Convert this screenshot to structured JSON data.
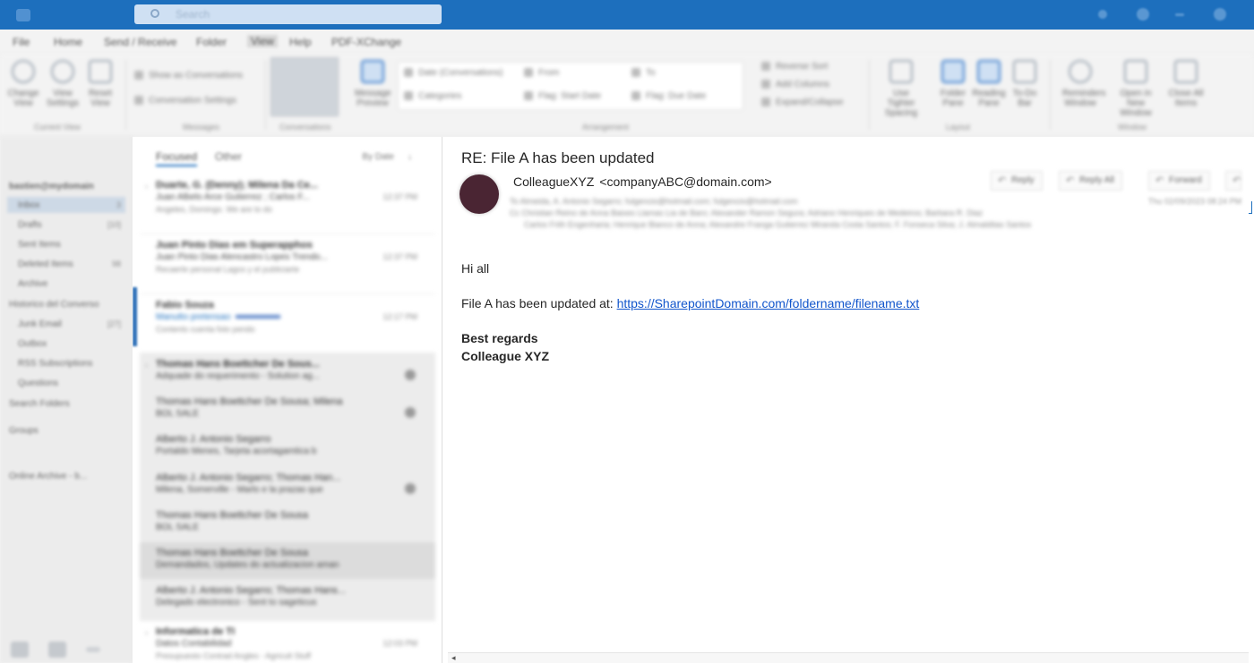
{
  "titlebar": {
    "search_placeholder": "Search"
  },
  "menu": [
    "File",
    "Home",
    "Send / Receive",
    "Folder",
    "View",
    "Help",
    "PDF-XChange"
  ],
  "ribbon": {
    "buttons": [
      "Change View",
      "View Settings",
      "Reset View",
      "Show as Conversations",
      "Conversation Settings",
      "Message Preview",
      "Arrange By",
      "Reverse Sort",
      "Add Columns",
      "Expand/Collapse",
      "Use Tighter Spacing",
      "Folder Pane",
      "Reading Pane",
      "To-Do Bar",
      "Reminders Window",
      "Open in New Window",
      "Close All Items"
    ],
    "groups": [
      "Current View",
      "Messages",
      "Conversations",
      "Arrangement",
      "Layout",
      "Window"
    ],
    "arrangement": [
      "Date (Conversations)",
      "From",
      "To",
      "Categories",
      "Flag: Start Date",
      "Flag: Due Date"
    ]
  },
  "folder_pane": {
    "account": "bastien@mydomain",
    "items": [
      {
        "label": "Inbox",
        "count": "3"
      },
      {
        "label": "Drafts",
        "count": "[10]"
      },
      {
        "label": "Sent Items",
        "count": ""
      },
      {
        "label": "Deleted Items",
        "count": "98"
      },
      {
        "label": "Archive",
        "count": ""
      },
      {
        "label": "Historico del Converso",
        "count": ""
      },
      {
        "label": "Junk Email",
        "count": "[27]"
      },
      {
        "label": "Outbox",
        "count": ""
      },
      {
        "label": "RSS Subscriptions",
        "count": ""
      },
      {
        "label": "Questions",
        "count": ""
      },
      {
        "label": "Search Folders",
        "count": ""
      },
      {
        "label": "Groups",
        "count": ""
      },
      {
        "label": "Online Archive - b...",
        "count": ""
      }
    ]
  },
  "message_list": {
    "tabs": [
      "Focused",
      "Other"
    ],
    "sort": "By Date",
    "rows": [
      {
        "sender": "Duarte, G. (Denny); Milena Da Ce...",
        "subject": "Juan Albelo Arce Gutierrez ; Carlos F...",
        "preview": "Angeles, Domingo. We are to do",
        "time": "12:37 PM",
        "badge": false
      },
      {
        "sender": "Juan Pinto Dias em Superapphos",
        "subject": "Juan Pinto Dias Alencastro Lopes Trendo...",
        "preview": "Recaerle personal Lagos y el publiciarte",
        "time": "12:37 PM",
        "badge": false
      },
      {
        "sender": "Fabio Souza",
        "subject": "Manutto pretensao",
        "preview": "Contents cuenta foto pendo",
        "time": "12:17 PM",
        "badge": false
      },
      {
        "sender": "Thomas Hans Boettcher De Sous...",
        "subject": "Adquade do requerimento - Solution ag...",
        "preview": "",
        "time": "",
        "badge": true
      },
      {
        "sender": "Thomas Hans Boettcher De Sousa; Milena",
        "subject": "BOL SALE",
        "preview": "",
        "time": "",
        "badge": true
      },
      {
        "sender": "Alberto J. Antonio Segarro",
        "subject": "Portaldo Menes, Tarjeta acortagamtica b",
        "preview": "",
        "time": "",
        "badge": false
      },
      {
        "sender": "Alberto J. Antonio Segarro; Thomas Han...",
        "subject": "Milena, Somerville - Marlo e la prazas que",
        "preview": "",
        "time": "",
        "badge": true
      },
      {
        "sender": "Thomas Hans Boettcher De Sousa",
        "subject": "BOL SALE",
        "preview": "",
        "time": "",
        "badge": false
      },
      {
        "sender": "Thomas Hans Boettcher De Sousa",
        "subject": "Demandados, Updates do actualizacion aman",
        "preview": "",
        "time": "",
        "badge": false
      },
      {
        "sender": "Alberto J. Antonio Segarro; Thomas Hans...",
        "subject": "Delegado electronico - Sent to sageticus",
        "preview": "",
        "time": "",
        "badge": false
      },
      {
        "sender": "Informatica de TI",
        "subject": "Datos Contabilidad",
        "preview": "Presupuesto Contrad Angles - Agricult Stuff",
        "time": "12:03 PM",
        "badge": false
      }
    ]
  },
  "reading": {
    "subject": "RE: File A has been updated",
    "from_name": "ColleagueXYZ",
    "from_addr": "<companyABC@domain.com>",
    "actions": [
      "Reply",
      "Reply All",
      "Forward"
    ],
    "to_line": "To   Almeida, A. Antonio Segarro; fulgencio@hotmail.com; fulgencio@hotmail.com",
    "cc_line": "Cc   Christian Reino de Anna Baixes Llamas Lia de Baro; Alexander Ramon Segura; Adriano Henriques de Medeiros; Barbara R. Diaz",
    "cc_line2": "Carlos Frith Engenharia; Henrique Bianco de Anna; Alexandre Franga Gutierrez Miranda Costa Santos; F. Fonseca Silva; J. Almalditas Santos",
    "date": "Thu 02/09/2023 08:24 PM",
    "greeting": "Hi all",
    "line_prefix": "File A has been updated at: ",
    "link": "https://SharepointDomain.com/foldername/filename.txt",
    "sig1": "Best regards",
    "sig2": "Colleague XYZ"
  }
}
